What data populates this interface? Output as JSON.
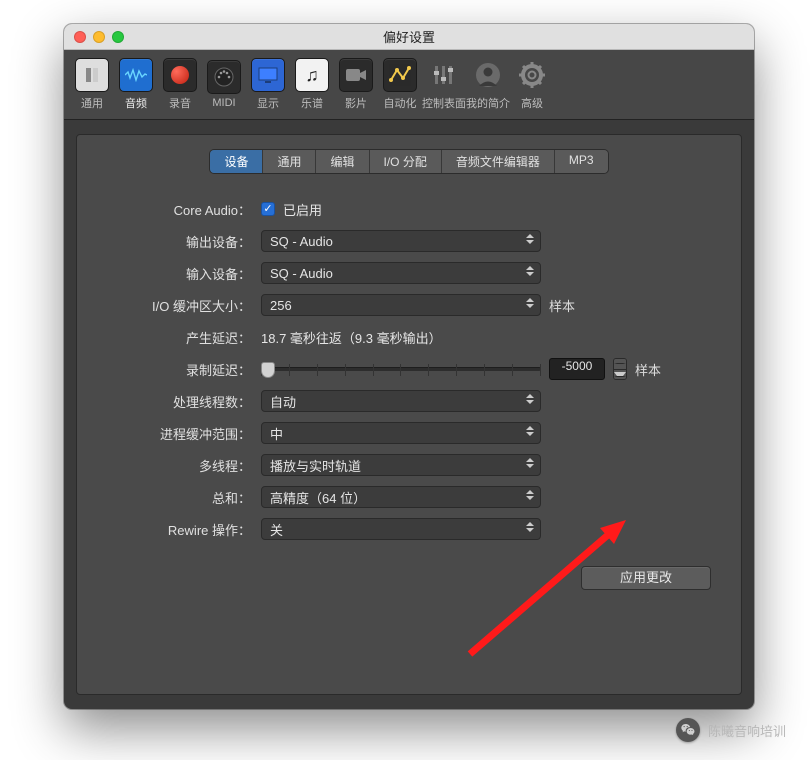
{
  "window": {
    "title": "偏好设置"
  },
  "toolbar": {
    "items": [
      {
        "id": "general-icon",
        "label": "通用"
      },
      {
        "id": "audio-icon",
        "label": "音频"
      },
      {
        "id": "record-icon",
        "label": "录音"
      },
      {
        "id": "midi-icon",
        "label": "MIDI"
      },
      {
        "id": "display-icon",
        "label": "显示"
      },
      {
        "id": "score-icon",
        "label": "乐谱"
      },
      {
        "id": "movie-icon",
        "label": "影片"
      },
      {
        "id": "automation-icon",
        "label": "自动化"
      },
      {
        "id": "controls-icon",
        "label": "控制表面"
      },
      {
        "id": "profile-icon",
        "label": "我的简介"
      },
      {
        "id": "advanced-icon",
        "label": "高级"
      }
    ]
  },
  "subtabs": [
    "设备",
    "通用",
    "编辑",
    "I/O 分配",
    "音频文件编辑器",
    "MP3"
  ],
  "form": {
    "core_audio_label": "Core Audio：",
    "core_audio_value": "已启用",
    "output_label": "输出设备：",
    "output_value": "SQ - Audio",
    "input_label": "输入设备：",
    "input_value": "SQ - Audio",
    "iobuf_label": "I/O 缓冲区大小：",
    "iobuf_value": "256",
    "iobuf_suffix": "样本",
    "latency_label": "产生延迟：",
    "latency_value": "18.7 毫秒往返（9.3 毫秒输出）",
    "reclat_label": "录制延迟：",
    "reclat_value": "-5000",
    "reclat_suffix": "样本",
    "threads_label": "处理线程数：",
    "threads_value": "自动",
    "procbuf_label": "进程缓冲范围：",
    "procbuf_value": "中",
    "multithread_label": "多线程：",
    "multithread_value": "播放与实时轨道",
    "sum_label": "总和：",
    "sum_value": "高精度（64 位）",
    "rewire_label": "Rewire 操作：",
    "rewire_value": "关"
  },
  "apply_button": "应用更改",
  "watermark": "陈曦音响培训"
}
